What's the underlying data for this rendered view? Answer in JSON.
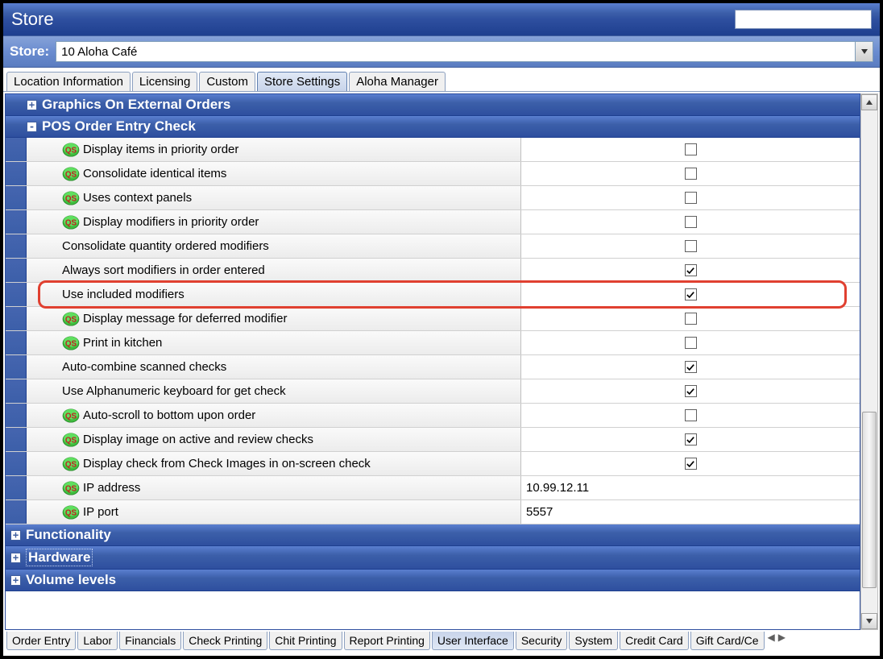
{
  "window_title": "Store",
  "store_label": "Store:",
  "store_value": "10 Aloha Café",
  "top_tabs": [
    {
      "label": "Location Information",
      "active": false
    },
    {
      "label": "Licensing",
      "active": false
    },
    {
      "label": "Custom",
      "active": false
    },
    {
      "label": "Store Settings",
      "active": true
    },
    {
      "label": "Aloha Manager",
      "active": false
    }
  ],
  "groups": {
    "graphics_external": {
      "label": "Graphics On External Orders",
      "expanded": false,
      "indented": true
    },
    "pos_order_entry": {
      "label": "POS Order Entry Check",
      "expanded": true,
      "indented": true
    },
    "functionality": {
      "label": "Functionality",
      "expanded": false
    },
    "hardware": {
      "label": "Hardware",
      "expanded": false,
      "dotted": true
    },
    "volume_levels": {
      "label": "Volume levels",
      "expanded": false
    }
  },
  "settings": [
    {
      "qs": true,
      "label": "Display items in priority order",
      "type": "check",
      "checked": false
    },
    {
      "qs": true,
      "label": "Consolidate identical items",
      "type": "check",
      "checked": false
    },
    {
      "qs": true,
      "label": "Uses context panels",
      "type": "check",
      "checked": false
    },
    {
      "qs": true,
      "label": "Display modifiers in priority order",
      "type": "check",
      "checked": false
    },
    {
      "qs": false,
      "label": "Consolidate quantity ordered modifiers",
      "type": "check",
      "checked": false
    },
    {
      "qs": false,
      "label": "Always sort modifiers in order entered",
      "type": "check",
      "checked": true
    },
    {
      "qs": false,
      "label": "Use included modifiers",
      "type": "check",
      "checked": true,
      "highlight": true
    },
    {
      "qs": true,
      "label": "Display message for deferred modifier",
      "type": "check",
      "checked": false
    },
    {
      "qs": true,
      "label": "Print in kitchen",
      "type": "check",
      "checked": false
    },
    {
      "qs": false,
      "label": "Auto-combine scanned checks",
      "type": "check",
      "checked": true
    },
    {
      "qs": false,
      "label": "Use Alphanumeric keyboard for get check",
      "type": "check",
      "checked": true
    },
    {
      "qs": true,
      "label": "Auto-scroll to bottom upon order",
      "type": "check",
      "checked": false
    },
    {
      "qs": true,
      "label": "Display image on active and review checks",
      "type": "check",
      "checked": true
    },
    {
      "qs": true,
      "label": "Display check from Check Images in on-screen check",
      "type": "check",
      "checked": true
    },
    {
      "qs": true,
      "label": "IP address",
      "type": "text",
      "value": "10.99.12.11"
    },
    {
      "qs": true,
      "label": "IP port",
      "type": "text",
      "value": "5557"
    }
  ],
  "bottom_tabs": [
    {
      "label": "Order Entry"
    },
    {
      "label": "Labor"
    },
    {
      "label": "Financials"
    },
    {
      "label": "Check Printing"
    },
    {
      "label": "Chit Printing"
    },
    {
      "label": "Report Printing"
    },
    {
      "label": "User Interface",
      "active": true
    },
    {
      "label": "Security"
    },
    {
      "label": "System"
    },
    {
      "label": "Credit Card"
    },
    {
      "label": "Gift Card/Ce"
    }
  ]
}
